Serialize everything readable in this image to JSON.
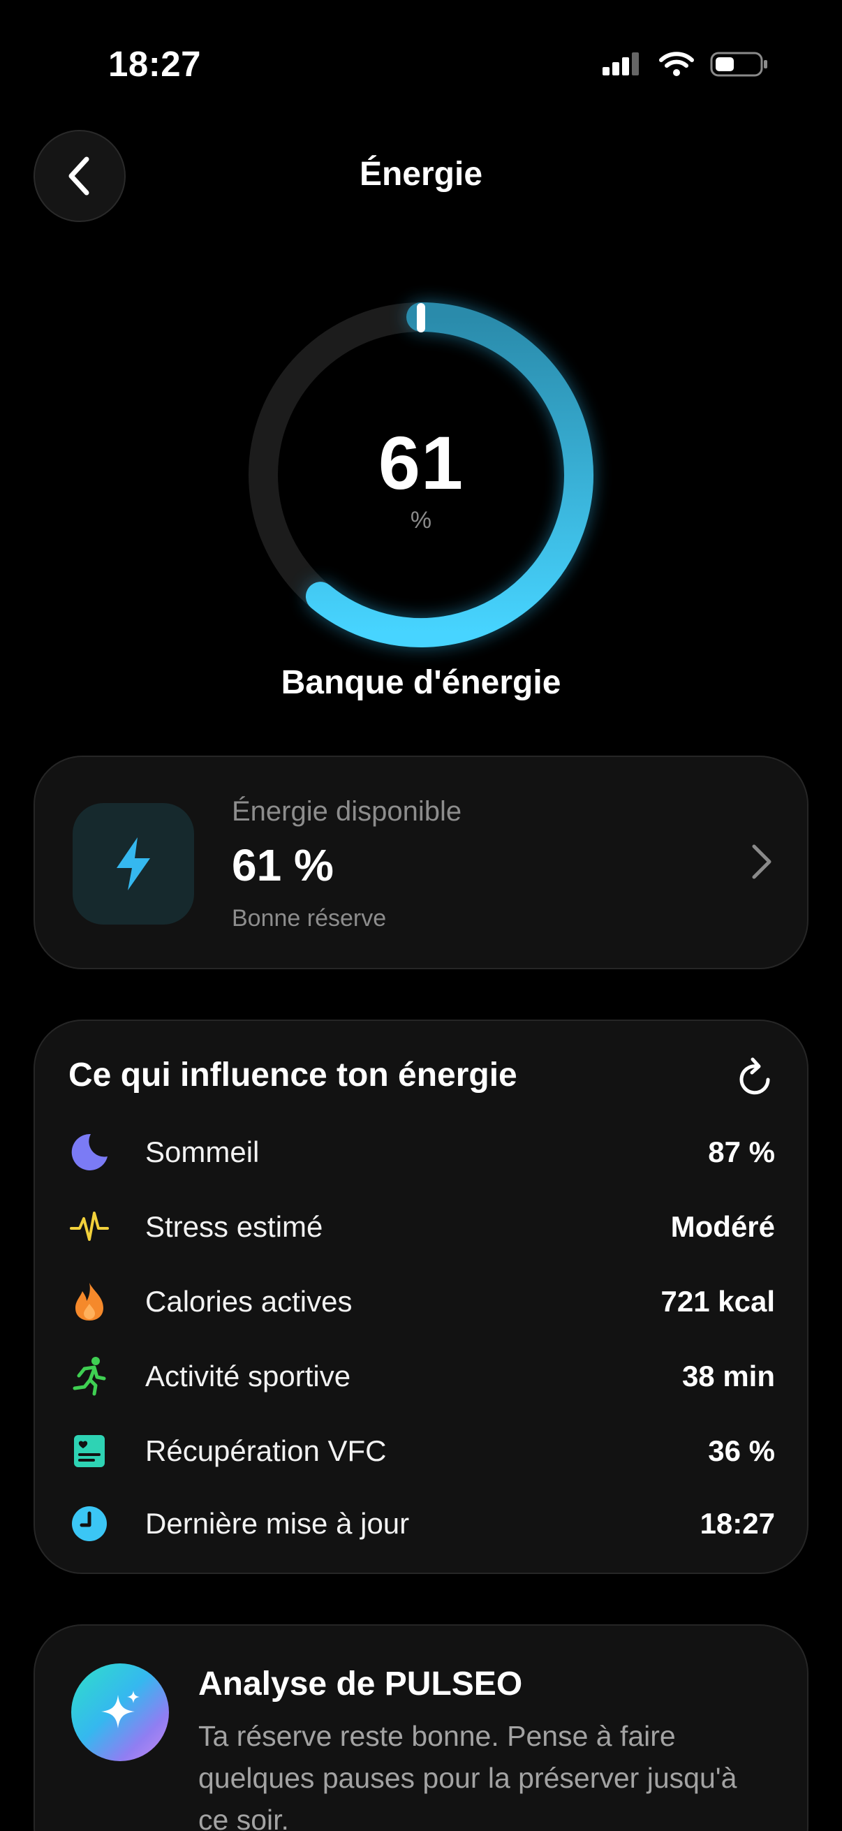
{
  "status_bar": {
    "time": "18:27"
  },
  "header": {
    "title": "Énergie"
  },
  "ring": {
    "value": "61",
    "unit": "%",
    "caption": "Banque d'énergie",
    "fraction": 0.61,
    "gradient_start": "#2a8bab",
    "gradient_end": "#47d4ff"
  },
  "energy_card": {
    "label": "Énergie disponible",
    "value": "61 %",
    "subtitle": "Bonne réserve",
    "icon": "bolt-icon",
    "accent": "#35b8ef"
  },
  "influences": {
    "title": "Ce qui influence ton énergie",
    "items": [
      {
        "icon": "moon-icon",
        "label": "Sommeil",
        "value": "87 %",
        "color": "#7b7bf5"
      },
      {
        "icon": "heartbeat-icon",
        "label": "Stress estimé",
        "value": "Modéré",
        "color": "#f2d13b"
      },
      {
        "icon": "flame-icon",
        "label": "Calories actives",
        "value": "721 kcal",
        "color": "#f5892b"
      },
      {
        "icon": "runner-icon",
        "label": "Activité sportive",
        "value": "38 min",
        "color": "#3fcf52"
      },
      {
        "icon": "hrv-card-icon",
        "label": "Récupération VFC",
        "value": "36 %",
        "color": "#2ed3b4"
      },
      {
        "icon": "clock-icon",
        "label": "Dernière mise à jour",
        "value": "18:27",
        "color": "#3bc6f5"
      }
    ]
  },
  "analysis": {
    "title": "Analyse de PULSEO",
    "text": "Ta réserve reste bonne. Pense à faire quelques pauses pour la préserver jusqu'à ce soir."
  }
}
